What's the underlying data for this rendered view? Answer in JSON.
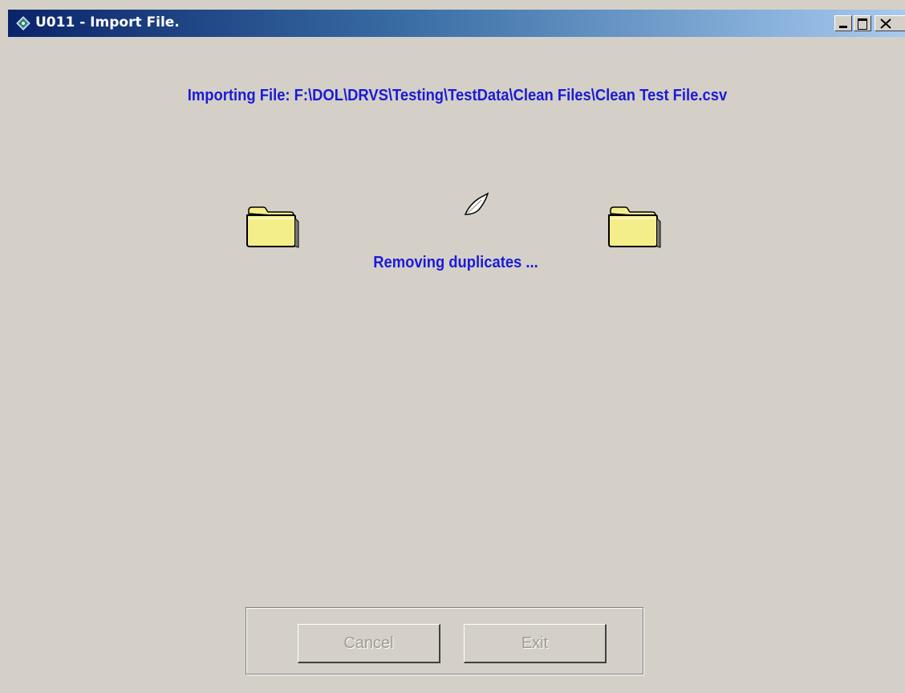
{
  "window": {
    "title": "U011 -  Import File.",
    "controls": {
      "minimize": "minimize-icon",
      "maximize": "maximize-icon",
      "close": "close-icon"
    }
  },
  "main": {
    "importing_label": "Importing File: F:\\DOL\\DRVS\\Testing\\TestData\\Clean Files\\Clean Test File.csv",
    "status_label": "Removing duplicates ..."
  },
  "icons": {
    "source": "folder-icon",
    "destination": "folder-icon",
    "transfer": "flying-document-icon"
  },
  "buttons": {
    "cancel_label": "Cancel",
    "exit_label": "Exit",
    "cancel_enabled": false,
    "exit_enabled": false
  },
  "colors": {
    "title_bar_start": "#0a246a",
    "title_bar_end": "#a6caf0",
    "label_text": "#1b1bd6",
    "window_background": "#d4d0c8",
    "folder_fill": "#f4ee8a"
  }
}
